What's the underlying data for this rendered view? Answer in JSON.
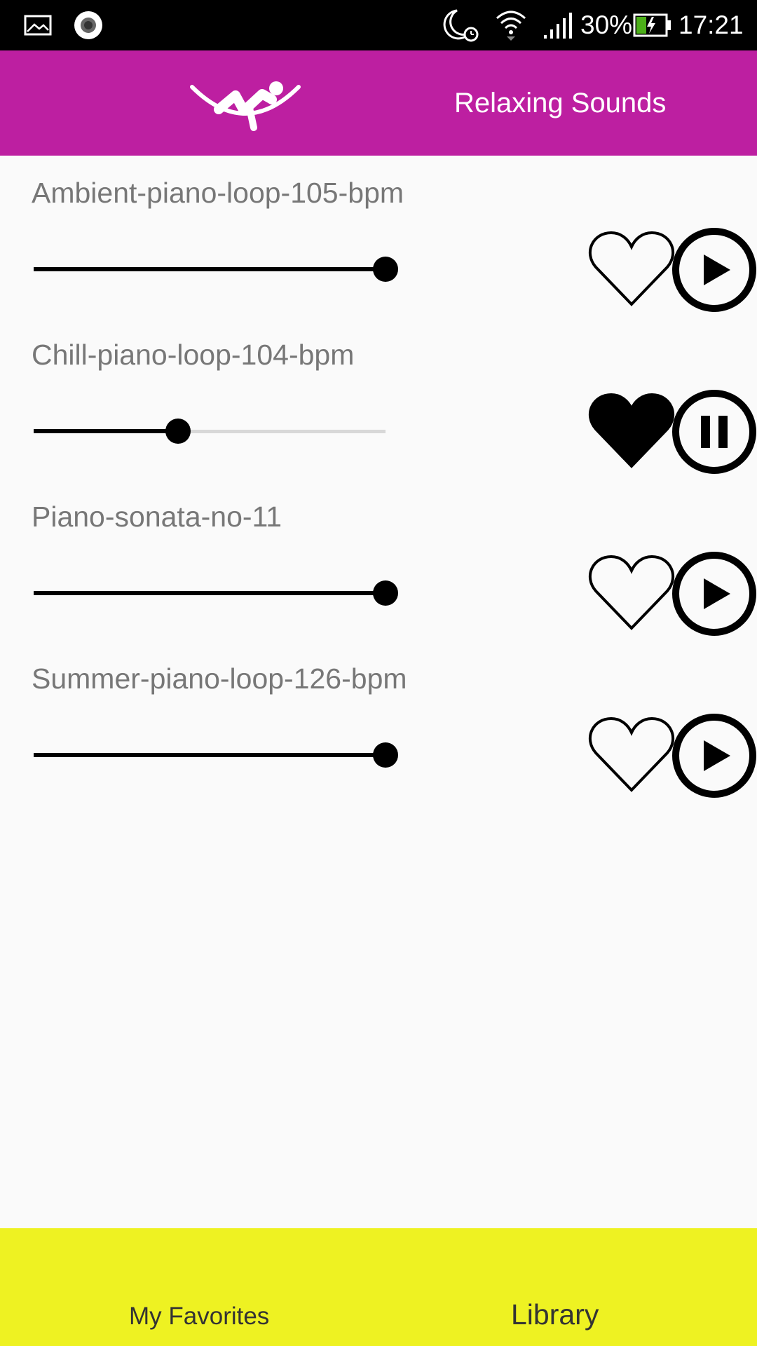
{
  "status_bar": {
    "icons": [
      "image-icon",
      "record-icon",
      "moon-alarm-icon",
      "wifi-icon",
      "signal-icon",
      "battery-charging-icon"
    ],
    "battery": "30%",
    "time": "17:21"
  },
  "header": {
    "logo_icon": "hammock-logo-icon",
    "title": "Relaxing Sounds",
    "background": "#bd1fa1"
  },
  "tracks": [
    {
      "title": "Ambient-piano-loop-105-bpm",
      "volume": 1.0,
      "favorite": false,
      "state": "paused"
    },
    {
      "title": "Chill-piano-loop-104-bpm",
      "volume": 0.41,
      "favorite": true,
      "state": "playing"
    },
    {
      "title": "Piano-sonata-no-11",
      "volume": 1.0,
      "favorite": false,
      "state": "paused"
    },
    {
      "title": "Summer-piano-loop-126-bpm",
      "volume": 1.0,
      "favorite": false,
      "state": "paused"
    }
  ],
  "bottom_nav": {
    "favorites_label": "My Favorites",
    "library_label": "Library",
    "background": "#eef222"
  }
}
